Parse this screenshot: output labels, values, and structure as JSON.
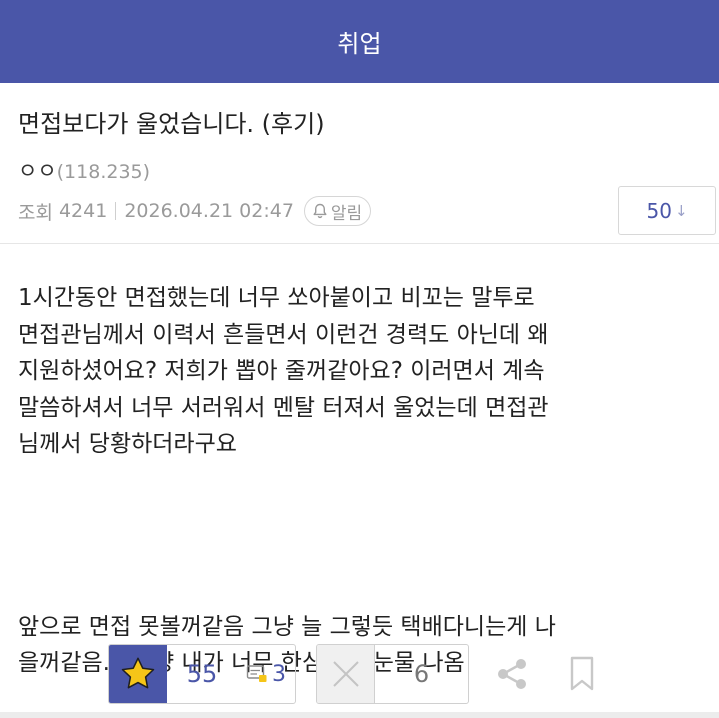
{
  "header": {
    "title": "취업"
  },
  "post": {
    "title": "면접보다가 울었습니다. (후기)",
    "author": "ㅇㅇ",
    "ip": "(118.235)",
    "views_label": "조회",
    "views": "4241",
    "datetime": "2026.04.21 02:47",
    "alert_label": "알림",
    "reply_count": "50",
    "reply_arrow": "↓"
  },
  "body": {
    "paragraph1": [
      "1시간동안 면접했는데 너무 쏘아붙이고 비꼬는 말투로",
      "면접관님께서 이력서 흔들면서 이런건 경력도 아닌데 왜",
      "지원하셨어요? 저희가 뽑아 줄꺼같아요? 이러면서 계속",
      "말씀하셔서 너무 서러워서 멘탈 터져서 울었는데 면접관",
      "님께서 당황하더라구요"
    ],
    "paragraph2": [
      "앞으로 면접 못볼꺼같음 그냥 늘 그렇듯 택배다니는게 나",
      "을꺼같음... 그냥 내가 너무 한심해서 눈물 나옴"
    ]
  },
  "actions": {
    "like_count": "55",
    "comment_count": "3",
    "dislike_count": "6"
  },
  "colors": {
    "brand": "#4a56a8",
    "star": "#f5c518",
    "muted": "#9a9a9a"
  },
  "icons": {
    "star": "star-icon",
    "comment": "comment-icon",
    "dislike": "close-icon",
    "share": "share-icon",
    "bookmark": "bookmark-icon",
    "bell": "bell-icon"
  }
}
